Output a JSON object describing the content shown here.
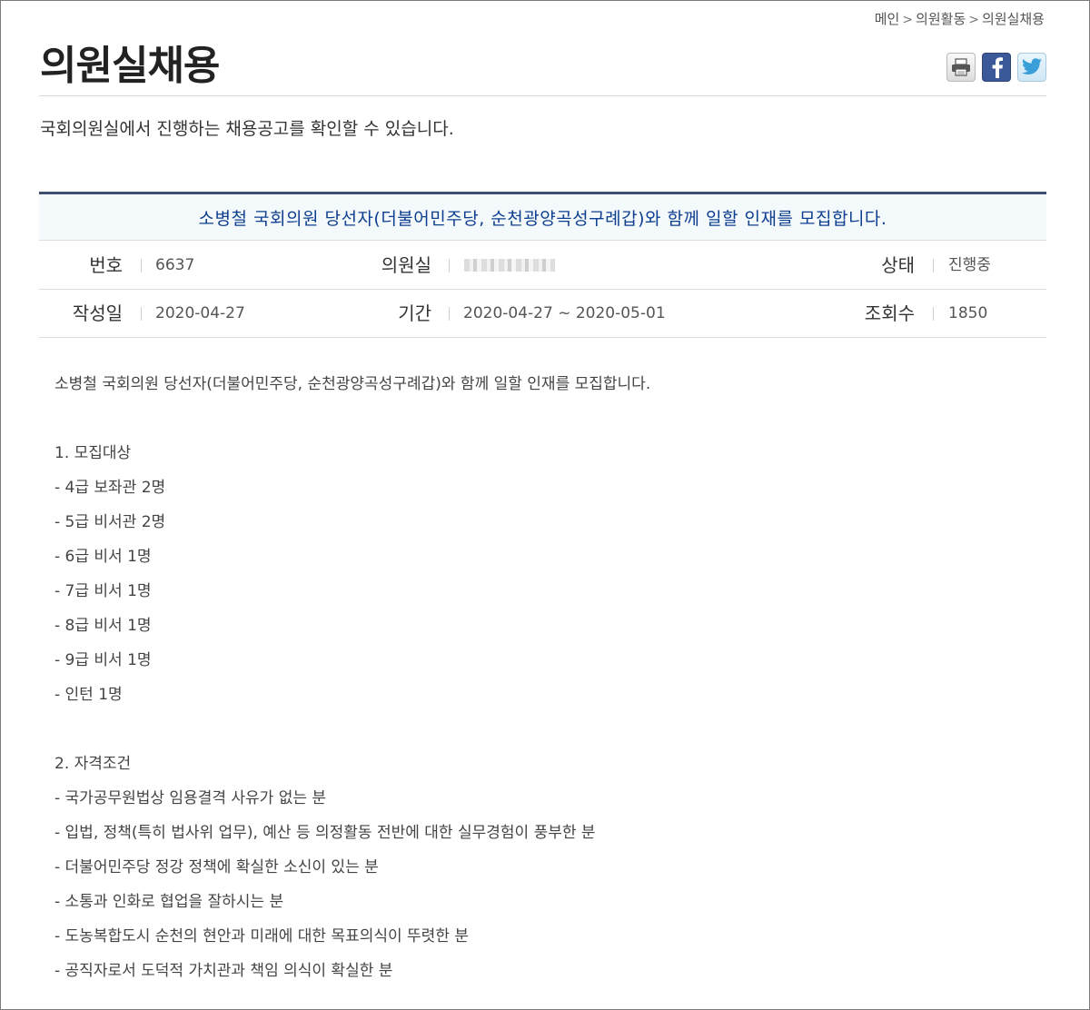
{
  "breadcrumb": [
    "메인",
    "의원활동",
    "의원실채용"
  ],
  "page": {
    "title": "의원실채용",
    "intro": "국회의원실에서 진행하는 채용공고를 확인할 수 있습니다."
  },
  "share": {
    "print_icon": "printer-icon",
    "facebook_icon": "facebook-icon",
    "twitter_icon": "twitter-icon"
  },
  "post": {
    "title": "소병철 국회의원 당선자(더불어민주당, 순천광양곡성구례갑)와 함께 일할 인재를 모집합니다.",
    "labels": {
      "number": "번호",
      "office": "의원실",
      "status": "상태",
      "date": "작성일",
      "period": "기간",
      "views": "조회수"
    },
    "number": "6637",
    "status": "진행중",
    "date": "2020-04-27",
    "period": "2020-04-27 ~ 2020-05-01",
    "views": "1850"
  },
  "content": {
    "intro": "소병철 국회의원 당선자(더불어민주당, 순천광양곡성구례갑)와 함께 일할 인재를 모집합니다.",
    "section1_title": "1. 모집대상",
    "section1_items": [
      "- 4급 보좌관 2명",
      "- 5급 비서관 2명",
      "- 6급 비서 1명",
      "- 7급 비서 1명",
      "- 8급 비서 1명",
      "- 9급 비서 1명",
      "- 인턴 1명"
    ],
    "section2_title": "2. 자격조건",
    "section2_items": [
      "- 국가공무원법상 임용결격 사유가 없는 분",
      "- 입법, 정책(특히 법사위 업무), 예산 등 의정활동 전반에 대한 실무경험이 풍부한 분",
      "- 더불어민주당 정강 정책에 확실한 소신이 있는 분",
      "- 소통과 인화로 협업을 잘하시는 분",
      "- 도농복합도시 순천의 현안과 미래에 대한 목표의식이 뚜렷한 분",
      "- 공직자로서 도덕적 가치관과 책임 의식이 확실한 분"
    ]
  },
  "colors": {
    "title_blue": "#0e3f8f",
    "header_rule": "#3d5070",
    "header_bg": "#f4f9fc"
  }
}
